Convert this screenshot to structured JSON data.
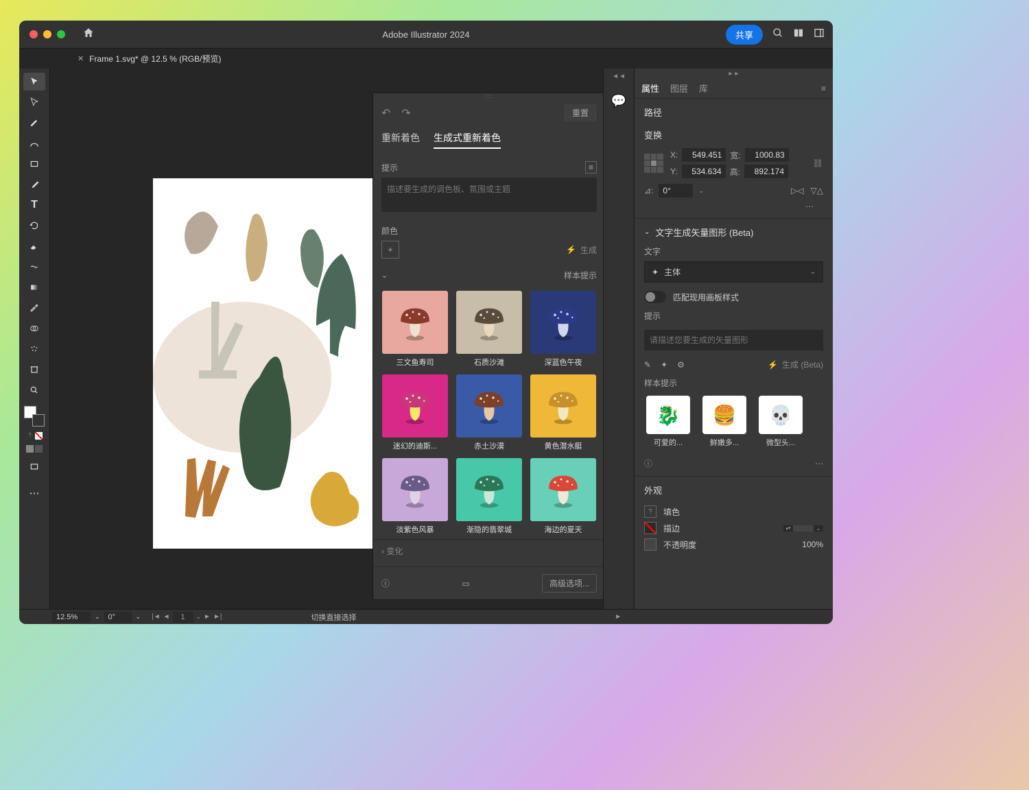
{
  "app": {
    "title": "Adobe Illustrator 2024",
    "share": "共享"
  },
  "document": {
    "tab_label": "Frame 1.svg* @ 12.5 % (RGB/预览)"
  },
  "recolor": {
    "reset": "重置",
    "tab_recolor": "重新着色",
    "tab_generative": "生成式重新着色",
    "prompt_label": "提示",
    "prompt_placeholder": "描述要生成的调色板、氛围或主题",
    "colors_label": "颜色",
    "generate": "生成",
    "samples_label": "样本提示",
    "samples": [
      {
        "label": "三文鱼寿司",
        "bg": "#e8a8a0"
      },
      {
        "label": "石质沙滩",
        "bg": "#c8bda8"
      },
      {
        "label": "深蓝色午夜",
        "bg": "#2a3a78"
      },
      {
        "label": "迷幻的迪斯...",
        "bg": "#d82888"
      },
      {
        "label": "赤土沙漠",
        "bg": "#3a5aa8"
      },
      {
        "label": "黄色潜水艇",
        "bg": "#f0b838"
      },
      {
        "label": "淡紫色风暴",
        "bg": "#c8a8d8"
      },
      {
        "label": "渐隐的翡翠城",
        "bg": "#48c8a8"
      },
      {
        "label": "海边的夏天",
        "bg": "#68d0b8"
      }
    ],
    "variations": "变化",
    "advanced": "高级选项..."
  },
  "properties": {
    "tabs": {
      "properties": "属性",
      "layers": "图层",
      "libraries": "库"
    },
    "path_label": "路径",
    "transform_label": "变换",
    "x_label": "X:",
    "x": "549.451",
    "y_label": "Y:",
    "y": "534.634",
    "w_label": "宽:",
    "w": "1000.83",
    "h_label": "高:",
    "h": "892.174",
    "rotate": "0°",
    "gen_vector_header": "文字生成矢量图形 (Beta)",
    "text_label": "文字",
    "subtype": "主体",
    "match_style": "匹配现用画板样式",
    "prompt_label": "提示",
    "prompt_placeholder": "请描述您要生成的矢量图形",
    "generate_beta": "生成 (Beta)",
    "samples_label": "样本提示",
    "samples": [
      {
        "label": "可爱的...",
        "emoji": "🐉"
      },
      {
        "label": "鲜嫩多...",
        "emoji": "🍔"
      },
      {
        "label": "微型头...",
        "emoji": "💀"
      }
    ],
    "appearance_label": "外观",
    "fill_label": "填色",
    "stroke_label": "描边",
    "opacity_label": "不透明度",
    "opacity": "100%"
  },
  "status": {
    "zoom": "12.5%",
    "angle": "0°",
    "page": "1",
    "hint": "切换直接选择"
  }
}
